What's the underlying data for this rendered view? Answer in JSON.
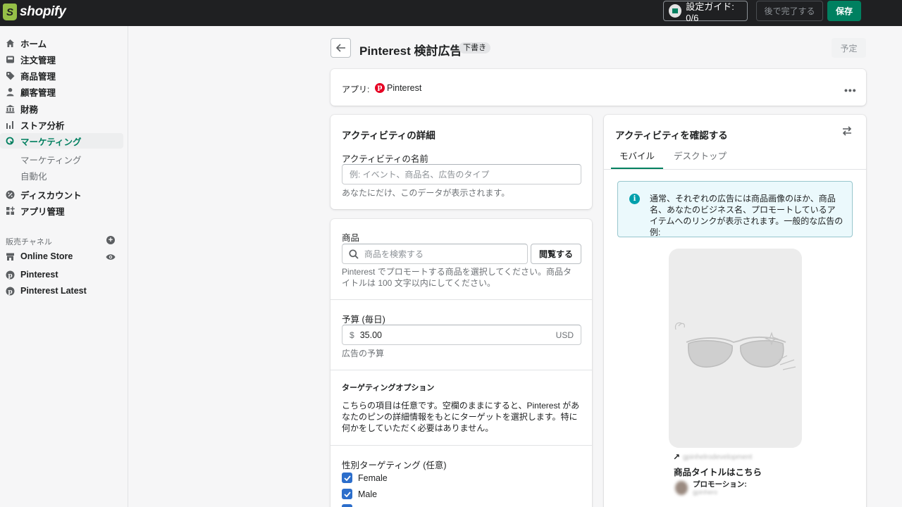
{
  "topbar": {
    "logo_text": "shopify",
    "setup_guide": "設定ガイド: 0/6",
    "finish_later": "後で完了する",
    "save": "保存"
  },
  "sidebar": {
    "items": [
      {
        "label": "ホーム",
        "icon": "home-icon"
      },
      {
        "label": "注文管理",
        "icon": "orders-icon"
      },
      {
        "label": "商品管理",
        "icon": "tag-icon"
      },
      {
        "label": "顧客管理",
        "icon": "person-icon"
      },
      {
        "label": "財務",
        "icon": "bank-icon"
      },
      {
        "label": "ストア分析",
        "icon": "analytics-icon"
      },
      {
        "label": "マーケティング",
        "icon": "marketing-icon"
      }
    ],
    "sub_items": [
      "マーケティング",
      "自動化"
    ],
    "items2": [
      {
        "label": "ディスカウント",
        "icon": "discount-icon"
      },
      {
        "label": "アプリ管理",
        "icon": "apps-icon"
      }
    ],
    "channels_label": "販売チャネル",
    "channels": [
      {
        "label": "Online Store",
        "icon": "store-icon"
      },
      {
        "label": "Pinterest",
        "icon": "pinterest-icon"
      },
      {
        "label": "Pinterest Latest",
        "icon": "pinterest-icon"
      }
    ]
  },
  "header": {
    "title": "Pinterest 検討広告",
    "badge": "下書き",
    "schedule": "予定"
  },
  "app_card": {
    "label": "アプリ:",
    "app_name": "Pinterest"
  },
  "details": {
    "heading": "アクティビティの詳細",
    "name_label": "アクティビティの名前",
    "name_placeholder": "例: イベント、商品名、広告のタイプ",
    "name_help": "あなたにだけ、このデータが表示されます。"
  },
  "product": {
    "label": "商品",
    "search_placeholder": "商品を検索する",
    "browse": "閲覧する",
    "help": "Pinterest でプロモートする商品を選択してください。商品タイトルは 100 文字以内にしてください。"
  },
  "budget": {
    "label": "予算 (毎日)",
    "currency_symbol": "$",
    "value": "35.00",
    "unit": "USD",
    "help": "広告の予算"
  },
  "targeting": {
    "heading": "ターゲティングオプション",
    "description": "こちらの項目は任意です。空欄のままにすると、Pinterest があなたのピンの詳細情報をもとにターゲットを選択します。特に何かをしていただく必要はありません。",
    "gender_label": "性別ターゲティング (任意)",
    "options": [
      {
        "label": "Female",
        "checked": true
      },
      {
        "label": "Male",
        "checked": true
      }
    ]
  },
  "preview": {
    "heading": "アクティビティを確認する",
    "tabs": [
      "モバイル",
      "デスクトップ"
    ],
    "active_tab": "モバイル",
    "info": "通常、それぞれの広告には商品画像のほか、商品名、あなたのビジネス名、プロモートしているアイテムへのリンクが表示されます。一般的な広告の例:",
    "pin_url": "gpinhelrodevelopment",
    "pin_title": "商品タイトルはこちら",
    "promo_label": "プロモーション:",
    "promo_name": "gpinhero"
  },
  "colors": {
    "accent": "#008060",
    "topbar": "#1f2022",
    "checkbox": "#2c6ecb",
    "pinterest": "#e60023"
  }
}
